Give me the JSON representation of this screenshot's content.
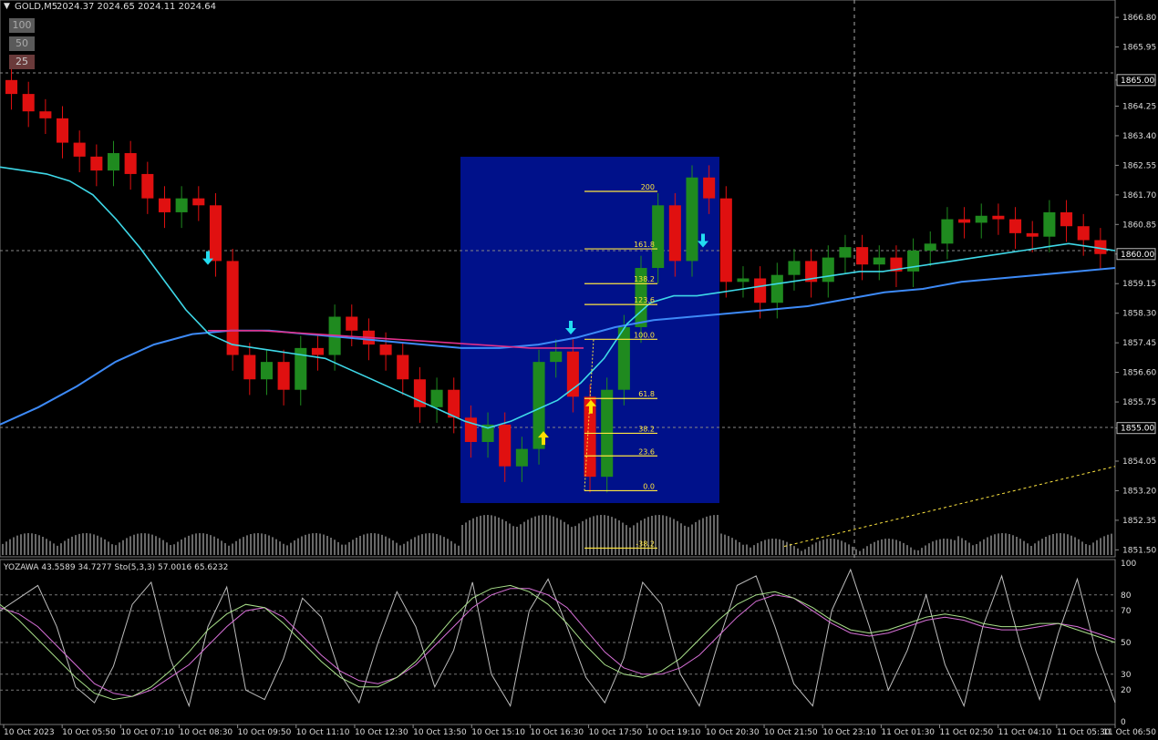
{
  "header": {
    "symbol": "GOLD,M5",
    "ohlc": "2024.37 2024.65 2024.11 2024.64",
    "menu_arrow": "▼"
  },
  "buttons": [
    {
      "label": "100"
    },
    {
      "label": "50"
    },
    {
      "label": "25"
    }
  ],
  "colors": {
    "bull": "#1f8a1f",
    "bear": "#e01010",
    "ema_fast": "#3ed8e8",
    "ema_slow": "#3d8af7",
    "mid_line": "#e0308a",
    "fib": "#ffe640",
    "fib_box": "#00118a",
    "arrow_up": "#ffe000",
    "arrow_down": "#22dcf0",
    "volume": "#cfcfcf",
    "stoch_main": "#bdbdbd",
    "stoch_signal": "#d870d8",
    "stoch_third": "#a9e08a"
  },
  "chart_data": [
    {
      "type": "candlestick",
      "title": "GOLD,M5",
      "ylim": [
        1851.3,
        1867.3
      ],
      "price_ticks": [
        "1866.80",
        "1865.95",
        "1865.00",
        "1864.25",
        "1863.40",
        "1862.55",
        "1861.70",
        "1860.85",
        "1860.00",
        "1859.15",
        "1858.30",
        "1857.45",
        "1856.60",
        "1855.75",
        "1855.00",
        "1854.05",
        "1853.20",
        "1852.35",
        "1851.50"
      ],
      "price_tags": [
        "1865.00",
        "1860.00",
        "1855.00"
      ],
      "time_labels": [
        "10 Oct 2023",
        "10 Oct 05:50",
        "10 Oct 07:10",
        "10 Oct 08:30",
        "10 Oct 09:50",
        "10 Oct 11:10",
        "10 Oct 12:30",
        "10 Oct 13:50",
        "10 Oct 15:10",
        "10 Oct 16:30",
        "10 Oct 17:50",
        "10 Oct 19:10",
        "10 Oct 20:30",
        "10 Oct 21:50",
        "10 Oct 23:10",
        "11 Oct 01:30",
        "11 Oct 02:50",
        "11 Oct 04:10",
        "11 Oct 05:30",
        "11 Oct 06:50"
      ],
      "fib_levels": [
        {
          "label": "200",
          "price": 1861.8
        },
        {
          "label": "161.8",
          "price": 1860.15
        },
        {
          "label": "138.2",
          "price": 1859.15
        },
        {
          "label": "123.6",
          "price": 1858.55
        },
        {
          "label": "100.0",
          "price": 1857.55
        },
        {
          "label": "61.8",
          "price": 1855.85
        },
        {
          "label": "38.2",
          "price": 1854.85
        },
        {
          "label": "23.6",
          "price": 1854.2
        },
        {
          "label": "0.0",
          "price": 1853.2
        },
        {
          "label": "-38.2",
          "price": 1851.55
        }
      ],
      "series": [
        {
          "name": "close",
          "values": [
            1864.6,
            1864.1,
            1863.9,
            1863.2,
            1862.8,
            1862.4,
            1862.9,
            1862.3,
            1861.6,
            1861.2,
            1861.6,
            1861.4,
            1859.8,
            1857.1,
            1856.4,
            1856.9,
            1856.1,
            1857.3,
            1857.1,
            1858.2,
            1857.8,
            1857.4,
            1857.1,
            1856.4,
            1855.6,
            1856.1,
            1855.3,
            1854.6,
            1855.1,
            1853.9,
            1854.4,
            1856.9,
            1857.2,
            1855.9,
            1853.6,
            1856.1,
            1857.9,
            1859.6,
            1861.4,
            1859.8,
            1862.2,
            1861.6,
            1859.2,
            1859.3,
            1858.6,
            1859.4,
            1859.8,
            1859.2,
            1859.9,
            1860.2,
            1859.7,
            1859.9,
            1859.5,
            1860.1,
            1860.3,
            1861.0,
            1860.9,
            1861.1,
            1861.0,
            1860.6,
            1860.5,
            1861.2,
            1860.8,
            1860.4,
            1860.0
          ]
        },
        {
          "name": "EMA fast",
          "values": [
            1862.5,
            1862.4,
            1862.3,
            1862.1,
            1861.7,
            1861.0,
            1860.2,
            1859.3,
            1858.4,
            1857.7,
            1857.4,
            1857.3,
            1857.2,
            1857.1,
            1857.0,
            1856.7,
            1856.4,
            1856.1,
            1855.8,
            1855.5,
            1855.2,
            1855.0,
            1855.2,
            1855.5,
            1855.8,
            1856.3,
            1857.0,
            1858.0,
            1858.6,
            1858.8,
            1858.8,
            1858.9,
            1859.0,
            1859.1,
            1859.2,
            1859.3,
            1859.4,
            1859.5,
            1859.5,
            1859.6,
            1859.7,
            1859.8,
            1859.9,
            1860.0,
            1860.1,
            1860.2,
            1860.3,
            1860.2,
            1860.1
          ]
        },
        {
          "name": "EMA slow",
          "values": [
            1855.1,
            1855.6,
            1856.2,
            1856.9,
            1857.4,
            1857.7,
            1857.8,
            1857.8,
            1857.7,
            1857.6,
            1857.5,
            1857.4,
            1857.3,
            1857.3,
            1857.4,
            1857.6,
            1857.9,
            1858.1,
            1858.2,
            1858.3,
            1858.4,
            1858.5,
            1858.7,
            1858.9,
            1859.0,
            1859.2,
            1859.3,
            1859.4,
            1859.5,
            1859.6
          ]
        }
      ]
    },
    {
      "type": "line",
      "title": "YOZAWA 43.5589 34.7277  Sto(5,3,3) 57.0016 65.6232",
      "ylim": [
        0,
        100
      ],
      "y_ticks": [
        "100",
        "80",
        "70",
        "50",
        "30",
        "20",
        "0"
      ],
      "series": [
        {
          "name": "stoch main",
          "values": [
            70,
            78,
            86,
            60,
            22,
            12,
            35,
            74,
            88,
            40,
            10,
            60,
            85,
            20,
            14,
            40,
            78,
            66,
            30,
            12,
            50,
            82,
            60,
            22,
            45,
            88,
            30,
            10,
            70,
            90,
            60,
            28,
            12,
            40,
            88,
            74,
            30,
            10,
            50,
            86,
            92,
            60,
            24,
            10,
            70,
            96,
            60,
            20,
            45,
            80,
            36,
            10,
            60,
            92,
            48,
            14,
            56,
            90,
            44,
            12
          ]
        },
        {
          "name": "stoch signal",
          "values": [
            72,
            68,
            60,
            48,
            36,
            24,
            18,
            16,
            20,
            28,
            36,
            48,
            60,
            70,
            72,
            66,
            54,
            42,
            32,
            26,
            24,
            28,
            36,
            48,
            60,
            72,
            80,
            84,
            84,
            80,
            72,
            58,
            44,
            34,
            30,
            30,
            34,
            42,
            54,
            66,
            76,
            80,
            78,
            70,
            62,
            56,
            54,
            56,
            60,
            64,
            66,
            64,
            60,
            58,
            58,
            60,
            62,
            60,
            56,
            52
          ]
        },
        {
          "name": "stoch third",
          "values": [
            74,
            64,
            52,
            40,
            28,
            18,
            14,
            16,
            22,
            32,
            44,
            58,
            68,
            74,
            72,
            62,
            50,
            38,
            28,
            22,
            22,
            28,
            38,
            52,
            66,
            78,
            84,
            86,
            82,
            74,
            62,
            48,
            36,
            30,
            28,
            32,
            40,
            52,
            64,
            74,
            80,
            82,
            78,
            72,
            64,
            58,
            56,
            58,
            62,
            66,
            68,
            66,
            62,
            60,
            60,
            62,
            62,
            58,
            54,
            50
          ]
        }
      ]
    }
  ]
}
